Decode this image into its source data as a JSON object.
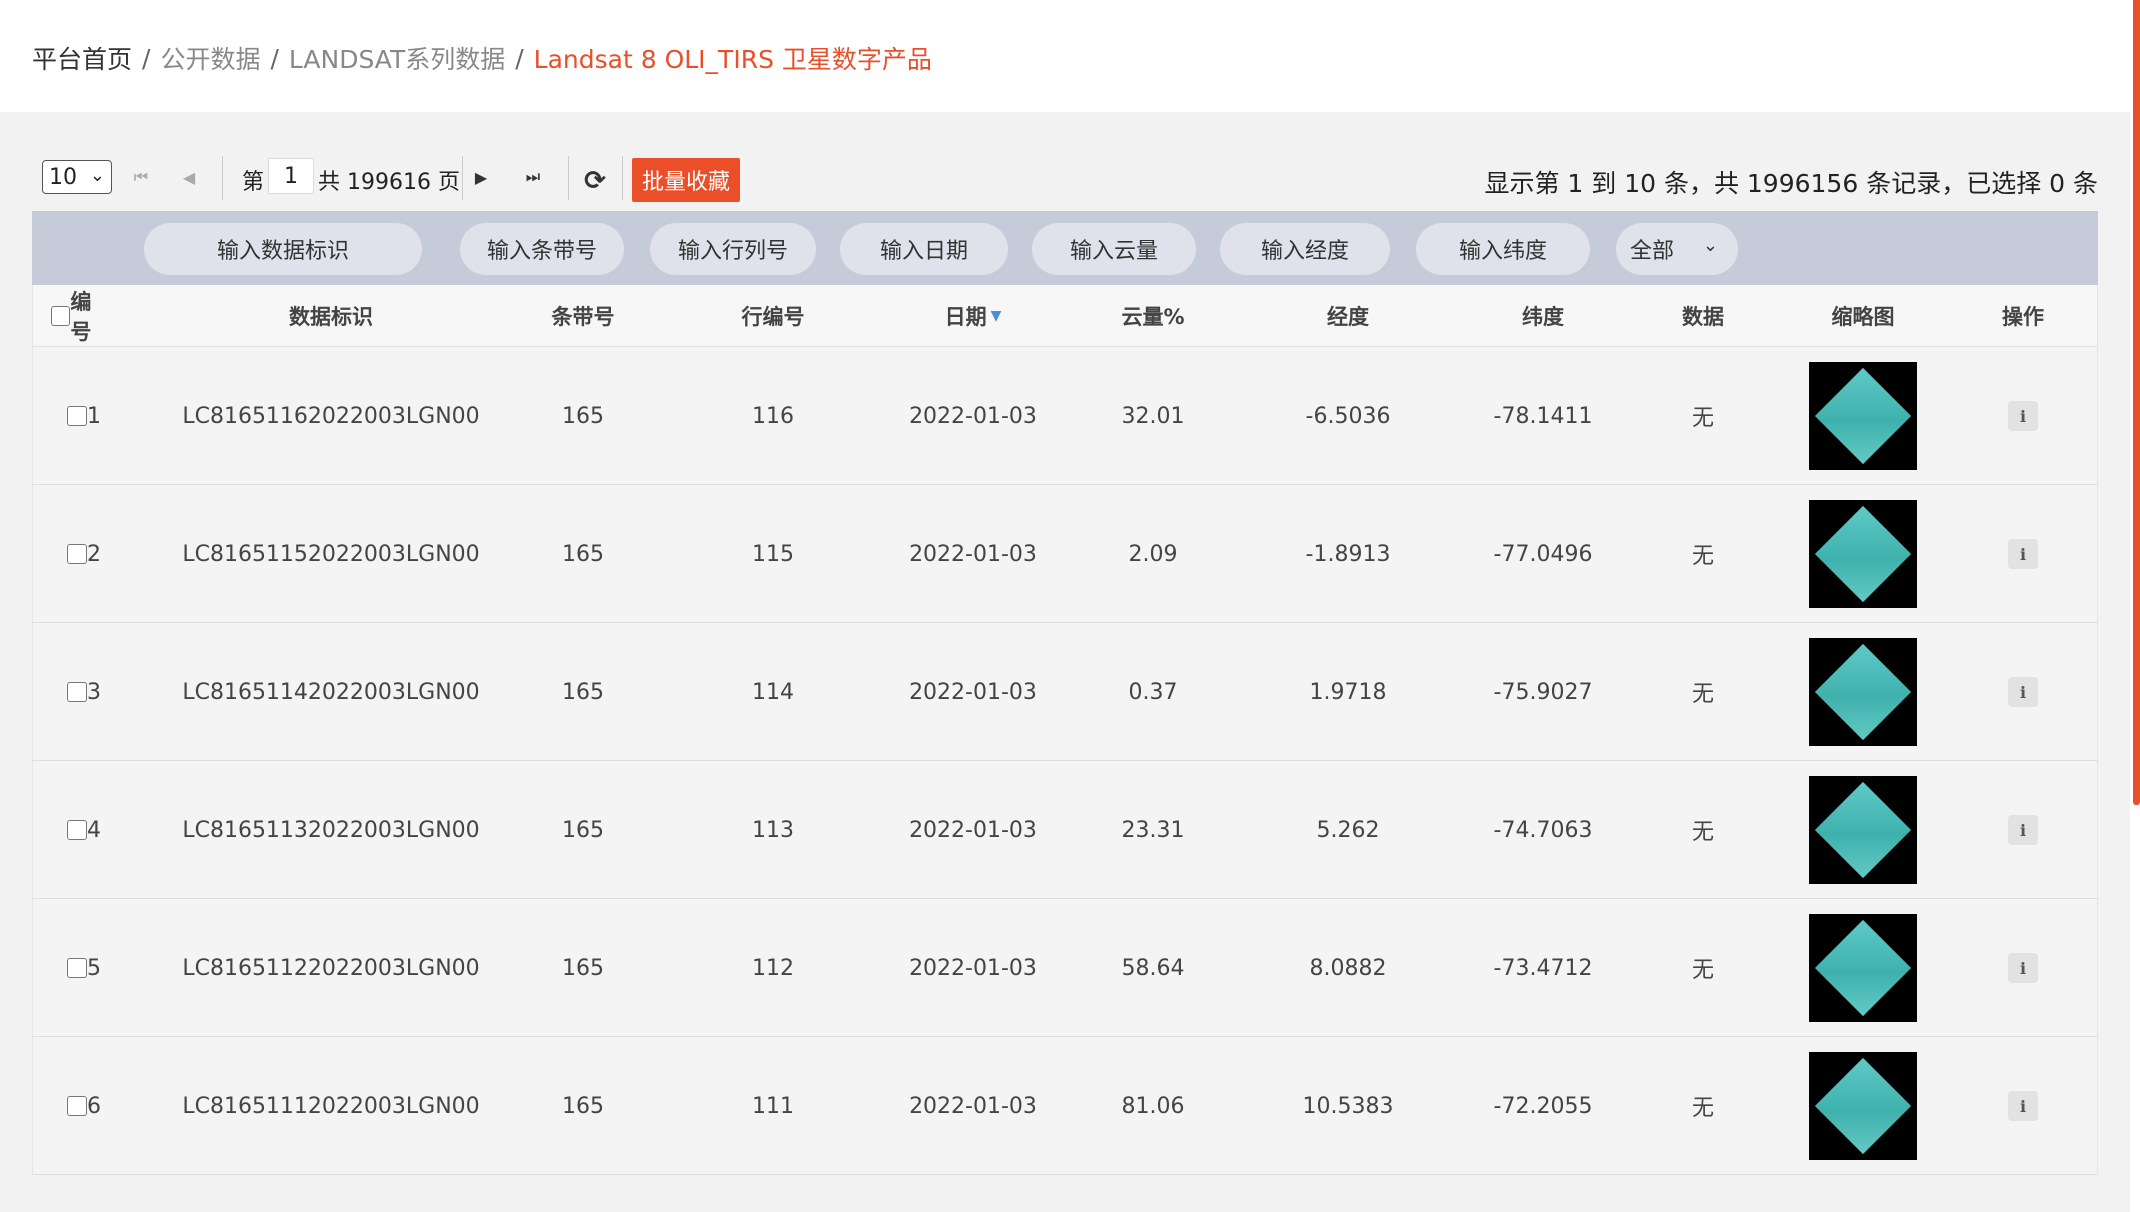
{
  "breadcrumb": {
    "home": "平台首页",
    "items": [
      "公开数据",
      "LANDSAT系列数据"
    ],
    "current": "Landsat 8 OLI_TIRS 卫星数字产品",
    "separator": "/"
  },
  "pagination": {
    "page_size": "10",
    "page_prefix": "第",
    "current_page": "1",
    "page_suffix": "共 199616 页",
    "batch_favorite": "批量收藏",
    "summary": "显示第 1 到 10 条，共 1996156 条记录，已选择 0 条"
  },
  "filters": {
    "data_id": "输入数据标识",
    "path": "输入条带号",
    "row": "输入行列号",
    "date": "输入日期",
    "cloud": "输入云量",
    "longitude": "输入经度",
    "latitude": "输入纬度",
    "data_select": "全部"
  },
  "columns": {
    "index": "编号",
    "data_id": "数据标识",
    "path": "条带号",
    "row": "行编号",
    "date": "日期",
    "cloud": "云量%",
    "longitude": "经度",
    "latitude": "纬度",
    "data": "数据",
    "thumbnail": "缩略图",
    "actions": "操作"
  },
  "rows": [
    {
      "index": "1",
      "data_id": "LC81651162022003LGN00",
      "path": "165",
      "row": "116",
      "date": "2022-01-03",
      "cloud": "32.01",
      "longitude": "-6.5036",
      "latitude": "-78.1411",
      "data": "无",
      "info": "i"
    },
    {
      "index": "2",
      "data_id": "LC81651152022003LGN00",
      "path": "165",
      "row": "115",
      "date": "2022-01-03",
      "cloud": "2.09",
      "longitude": "-1.8913",
      "latitude": "-77.0496",
      "data": "无",
      "info": "i"
    },
    {
      "index": "3",
      "data_id": "LC81651142022003LGN00",
      "path": "165",
      "row": "114",
      "date": "2022-01-03",
      "cloud": "0.37",
      "longitude": "1.9718",
      "latitude": "-75.9027",
      "data": "无",
      "info": "i"
    },
    {
      "index": "4",
      "data_id": "LC81651132022003LGN00",
      "path": "165",
      "row": "113",
      "date": "2022-01-03",
      "cloud": "23.31",
      "longitude": "5.262",
      "latitude": "-74.7063",
      "data": "无",
      "info": "i"
    },
    {
      "index": "5",
      "data_id": "LC81651122022003LGN00",
      "path": "165",
      "row": "112",
      "date": "2022-01-03",
      "cloud": "58.64",
      "longitude": "8.0882",
      "latitude": "-73.4712",
      "data": "无",
      "info": "i"
    },
    {
      "index": "6",
      "data_id": "LC81651112022003LGN00",
      "path": "165",
      "row": "111",
      "date": "2022-01-03",
      "cloud": "81.06",
      "longitude": "10.5383",
      "latitude": "-72.2055",
      "data": "无",
      "info": "i"
    }
  ],
  "colors": {
    "accent": "#e8502b",
    "filter_bar": "#c5cbd9",
    "pill": "#dfe2ea",
    "thumbnail_scene": "#4fbdb8"
  },
  "icons": {
    "first_page": "first-page-icon",
    "prev_page": "prev-page-icon",
    "next_page": "next-page-icon",
    "last_page": "last-page-icon",
    "refresh": "refresh-icon",
    "sort": "sort-down-icon",
    "info": "info-icon"
  }
}
